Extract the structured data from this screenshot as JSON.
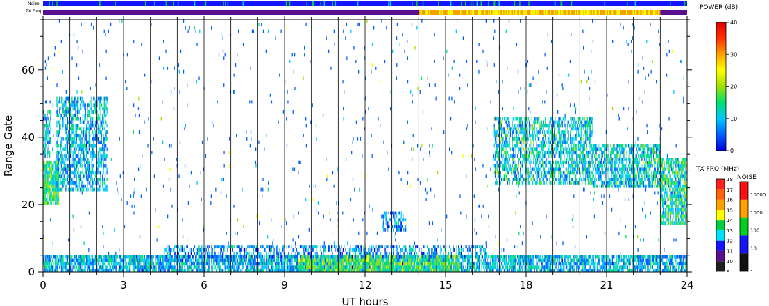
{
  "chart_data": {
    "type": "heatmap",
    "xlabel": "UT hours",
    "ylabel": "Range Gate",
    "xlim": [
      0,
      24
    ],
    "ylim": [
      0,
      75
    ],
    "xticks": [
      "0",
      "3",
      "6",
      "9",
      "12",
      "15",
      "18",
      "21",
      "24"
    ],
    "yticks": [
      "0",
      "20",
      "40",
      "60"
    ],
    "hour_lines": true,
    "strips": {
      "noise_label": "Noise",
      "txfreq_label": "TX Freq",
      "txfreq_segments": [
        {
          "start": 0,
          "end": 14,
          "color": "#5a0f8f"
        },
        {
          "start": 14,
          "end": 23,
          "color": "#f5a000"
        },
        {
          "start": 23,
          "end": 24,
          "color": "#5a0f8f"
        }
      ],
      "noise_color": "#1414ff"
    },
    "echo_regions": [
      {
        "x0": 0,
        "x1": 24,
        "g0": 0,
        "g1": 5,
        "level": 8,
        "density": 0.75
      },
      {
        "x0": 9.5,
        "x1": 15.5,
        "g0": 0,
        "g1": 5,
        "level": 15,
        "density": 0.85
      },
      {
        "x0": 4.5,
        "x1": 16.5,
        "g0": 4,
        "g1": 8,
        "level": 6,
        "density": 0.45
      },
      {
        "x0": 0,
        "x1": 0.6,
        "g0": 20,
        "g1": 33,
        "level": 14,
        "density": 0.9
      },
      {
        "x0": 0,
        "x1": 0.3,
        "g0": 34,
        "g1": 48,
        "level": 8,
        "density": 0.5
      },
      {
        "x0": 0.5,
        "x1": 2.4,
        "g0": 24,
        "g1": 52,
        "level": 8,
        "density": 0.55
      },
      {
        "x0": 16.8,
        "x1": 20.5,
        "g0": 26,
        "g1": 46,
        "level": 10,
        "density": 0.55
      },
      {
        "x0": 20.5,
        "x1": 23.0,
        "g0": 25,
        "g1": 38,
        "level": 10,
        "density": 0.65
      },
      {
        "x0": 23.0,
        "x1": 24,
        "g0": 14,
        "g1": 34,
        "level": 12,
        "density": 0.75
      },
      {
        "x0": 12.6,
        "x1": 13.5,
        "g0": 12,
        "g1": 18,
        "level": 5,
        "density": 0.5
      }
    ],
    "power_colorbar": {
      "title": "POWER (dB)",
      "ticks": [
        "0",
        "10",
        "20",
        "30",
        "40"
      ],
      "stops": [
        "#0000e0",
        "#0060ff",
        "#00c8ff",
        "#00e070",
        "#a0e000",
        "#ffff00",
        "#ffa000",
        "#ff3000",
        "#e00000"
      ]
    },
    "txfreq_colorbar": {
      "title": "TX FRQ (MHz)",
      "ticks": [
        "9",
        "10",
        "11",
        "12",
        "13",
        "14",
        "15",
        "16",
        "17",
        "18"
      ],
      "colors": [
        "#202020",
        "#5a0f8f",
        "#1414ff",
        "#00e0ff",
        "#00d040",
        "#ffff00",
        "#ffa000",
        "#ff6010",
        "#ff2020"
      ]
    },
    "noise_colorbar": {
      "title": "NOISE",
      "ticks": [
        "1",
        "10",
        "100",
        "1000",
        "10000"
      ],
      "colors": [
        "#101010",
        "#1414ff",
        "#00d020",
        "#ffa000",
        "#ff1010"
      ]
    }
  }
}
